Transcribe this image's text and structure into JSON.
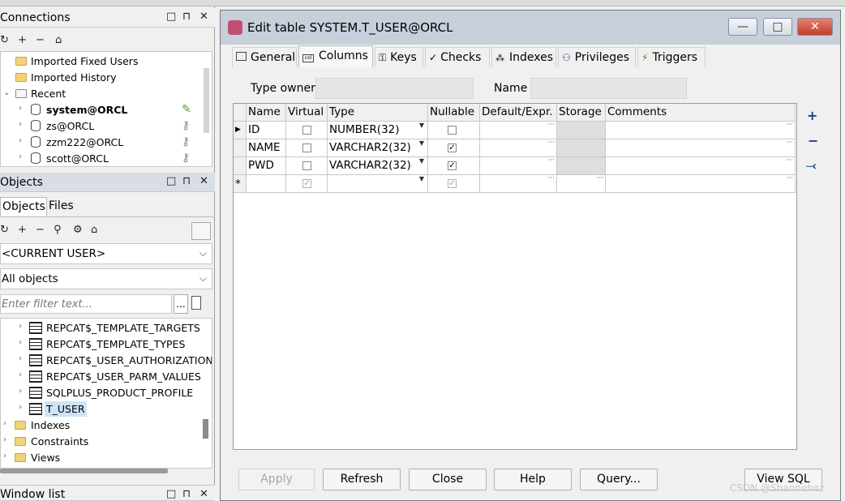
{
  "left_panel": {
    "connections": {
      "title": "Connections",
      "window_buttons": [
        "□",
        "⊓",
        "✕"
      ],
      "toolbar": [
        "↻",
        "+",
        "−",
        "⌂"
      ],
      "tree": [
        {
          "label": "Imported Fixed Users",
          "bold": false
        },
        {
          "label": "Imported History",
          "bold": false
        },
        {
          "label": "Recent",
          "bold": false
        },
        {
          "label": "system@ORCL",
          "bold": true
        },
        {
          "label": "zs@ORCL",
          "bold": false
        },
        {
          "label": "zzm222@ORCL",
          "bold": false
        },
        {
          "label": "scott@ORCL",
          "bold": false
        }
      ]
    },
    "objects": {
      "title": "Objects",
      "window_buttons": [
        "□",
        "⊓",
        "✕"
      ],
      "tabs": [
        "Objects",
        "Files"
      ],
      "toolbar": [
        "↻",
        "+",
        "−",
        "⚲",
        "⚙",
        "⌂"
      ],
      "user_combo": "<CURRENT USER>",
      "filter_combo": "All objects",
      "filter_placeholder": "Enter filter text...",
      "filter_button": "...",
      "tree": [
        {
          "label": "REPCAT$_TEMPLATE_TARGETS"
        },
        {
          "label": "REPCAT$_TEMPLATE_TYPES"
        },
        {
          "label": "REPCAT$_USER_AUTHORIZATION"
        },
        {
          "label": "REPCAT$_USER_PARM_VALUES"
        },
        {
          "label": "SQLPLUS_PRODUCT_PROFILE"
        },
        {
          "label": "T_USER",
          "selected": true
        },
        {
          "label": "Indexes"
        },
        {
          "label": "Constraints"
        },
        {
          "label": "Views"
        }
      ]
    },
    "window_list": {
      "title": "Window list",
      "window_buttons": [
        "□",
        "⊓",
        "✕"
      ]
    }
  },
  "dialog": {
    "title": "Edit table SYSTEM.T_USER@ORCL",
    "window_buttons": {
      "minimize": "—",
      "maximize": "□",
      "close": "✕"
    },
    "tabs": [
      "General",
      "Columns",
      "Keys",
      "Checks",
      "Indexes",
      "Privileges",
      "Triggers"
    ],
    "active_tab": "Columns",
    "type_owner_label": "Type owner",
    "name_label": "Name",
    "grid": {
      "headers": [
        "Name",
        "Virtual",
        "Type",
        "Nullable",
        "Default/Expr.",
        "Storage",
        "Comments"
      ],
      "rows": [
        {
          "indicator": "▶",
          "name": "ID",
          "virtual": false,
          "type": "NUMBER(32)",
          "nullable": false
        },
        {
          "indicator": "",
          "name": "NAME",
          "virtual": false,
          "type": "VARCHAR2(32)",
          "nullable": true
        },
        {
          "indicator": "",
          "name": "PWD",
          "virtual": false,
          "type": "VARCHAR2(32)",
          "nullable": true
        },
        {
          "indicator": "*",
          "name": "",
          "virtual": true,
          "type": "",
          "nullable": true
        }
      ]
    },
    "side_buttons": [
      "+",
      "−",
      "⤙"
    ],
    "buttons": [
      {
        "label": "Apply",
        "enabled": false
      },
      {
        "label": "Refresh",
        "enabled": true
      },
      {
        "label": "Close",
        "enabled": true
      },
      {
        "label": "Help",
        "enabled": true
      },
      {
        "label": "Query...",
        "enabled": true
      },
      {
        "label": "View SQL",
        "enabled": true
      }
    ]
  },
  "watermark": "CSDN @Shannehez"
}
